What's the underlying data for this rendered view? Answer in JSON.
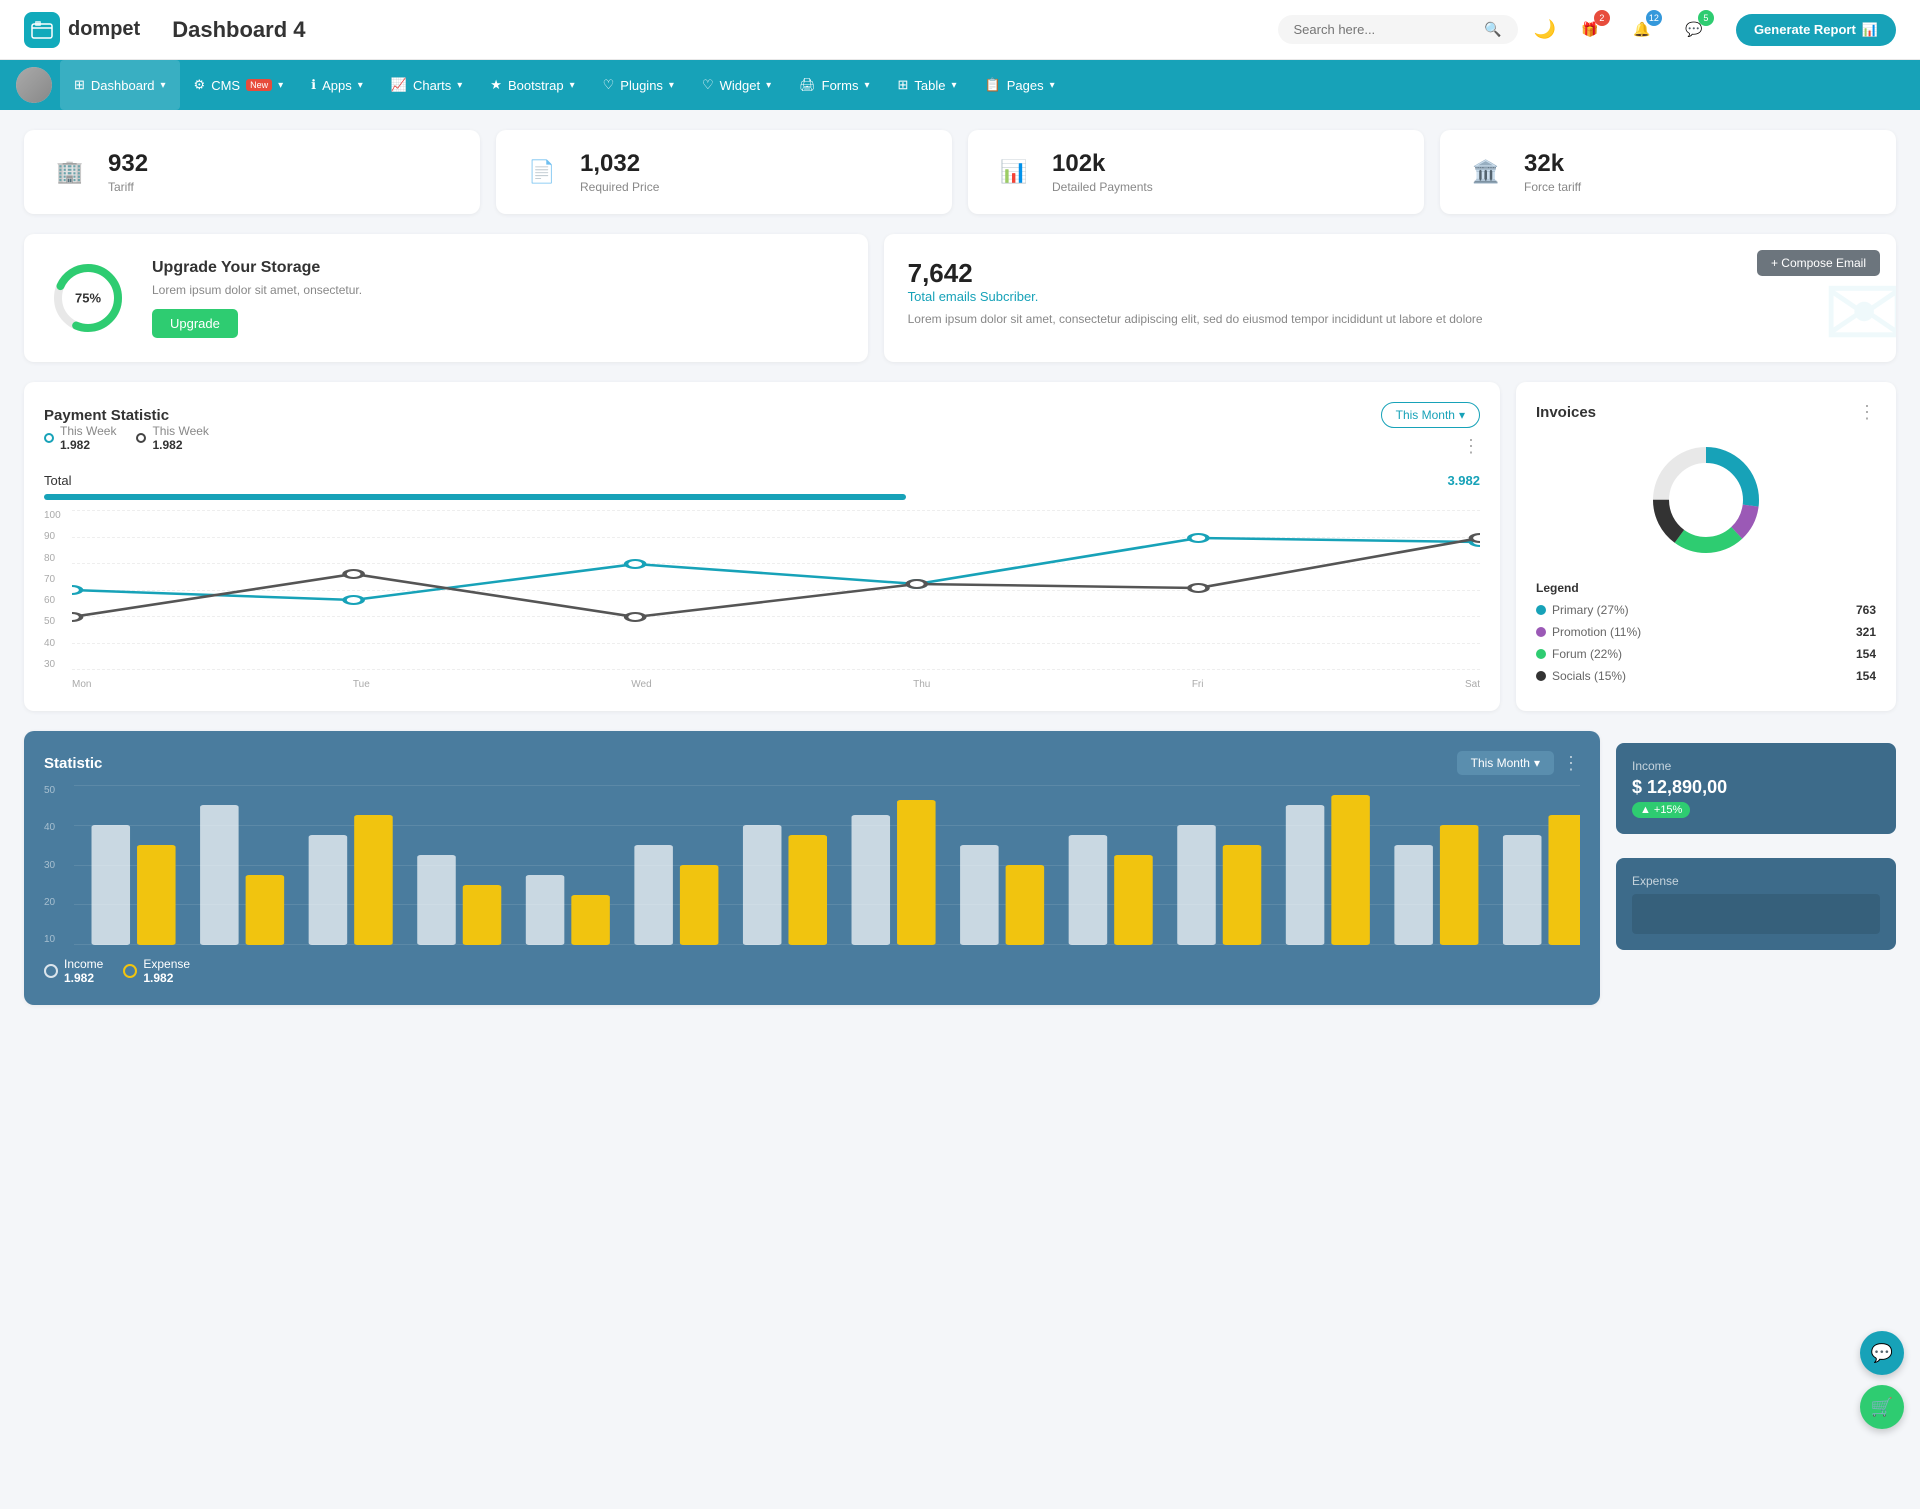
{
  "header": {
    "logo_text": "dompet",
    "page_title": "Dashboard 4",
    "search_placeholder": "Search here...",
    "generate_btn": "Generate Report",
    "icons": {
      "gift_badge": "2",
      "bell_badge": "12",
      "chat_badge": "5"
    }
  },
  "nav": {
    "items": [
      {
        "id": "dashboard",
        "label": "Dashboard",
        "active": true,
        "has_arrow": true
      },
      {
        "id": "cms",
        "label": "CMS",
        "is_new": true,
        "has_arrow": true
      },
      {
        "id": "apps",
        "label": "Apps",
        "has_arrow": true
      },
      {
        "id": "charts",
        "label": "Charts",
        "has_arrow": true
      },
      {
        "id": "bootstrap",
        "label": "Bootstrap",
        "has_arrow": true
      },
      {
        "id": "plugins",
        "label": "Plugins",
        "has_arrow": true
      },
      {
        "id": "widget",
        "label": "Widget",
        "has_arrow": true
      },
      {
        "id": "forms",
        "label": "Forms",
        "has_arrow": true
      },
      {
        "id": "table",
        "label": "Table",
        "has_arrow": true
      },
      {
        "id": "pages",
        "label": "Pages",
        "has_arrow": true
      }
    ]
  },
  "stat_cards": [
    {
      "id": "tariff",
      "value": "932",
      "label": "Tariff",
      "icon": "🏢",
      "color": "teal"
    },
    {
      "id": "required_price",
      "value": "1,032",
      "label": "Required Price",
      "icon": "📄",
      "color": "red"
    },
    {
      "id": "detailed_payments",
      "value": "102k",
      "label": "Detailed Payments",
      "icon": "📊",
      "color": "purple"
    },
    {
      "id": "force_tariff",
      "value": "32k",
      "label": "Force tariff",
      "icon": "🏛️",
      "color": "pink"
    }
  ],
  "storage_card": {
    "percent": "75%",
    "title": "Upgrade Your Storage",
    "description": "Lorem ipsum dolor sit amet, onsectetur.",
    "button_label": "Upgrade"
  },
  "email_card": {
    "count": "7,642",
    "subtitle": "Total emails Subcriber.",
    "description": "Lorem ipsum dolor sit amet, consectetur adipiscing elit, sed do eiusmod tempor incididunt ut labore et dolore",
    "compose_btn": "+ Compose Email"
  },
  "payment_statistic": {
    "title": "Payment Statistic",
    "legend": [
      {
        "label": "This Week",
        "value": "1.982",
        "color": "teal"
      },
      {
        "label": "This Week",
        "value": "1.982",
        "color": "dark"
      }
    ],
    "month_btn": "This Month",
    "total_label": "Total",
    "total_value": "3.982",
    "x_labels": [
      "Mon",
      "Tue",
      "Wed",
      "Thu",
      "Fri",
      "Sat"
    ],
    "y_labels": [
      "100",
      "90",
      "80",
      "70",
      "60",
      "50",
      "40",
      "30"
    ]
  },
  "invoices": {
    "title": "Invoices",
    "legend": [
      {
        "label": "Primary (27%)",
        "value": "763",
        "color": "#17a2b8"
      },
      {
        "label": "Promotion (11%)",
        "value": "321",
        "color": "#9b59b6"
      },
      {
        "label": "Forum (22%)",
        "value": "154",
        "color": "#2ecc71"
      },
      {
        "label": "Socials (15%)",
        "value": "154",
        "color": "#333"
      }
    ]
  },
  "statistic": {
    "title": "Statistic",
    "month_btn": "This Month",
    "y_labels": [
      "50",
      "40",
      "30",
      "20",
      "10"
    ],
    "income": {
      "legend_label": "Income",
      "legend_value": "1.982",
      "box_label": "Income",
      "box_value": "$ 12,890,00",
      "badge": "+15%"
    },
    "expense": {
      "legend_label": "Expense",
      "legend_value": "1.982",
      "box_label": "Expense"
    }
  }
}
